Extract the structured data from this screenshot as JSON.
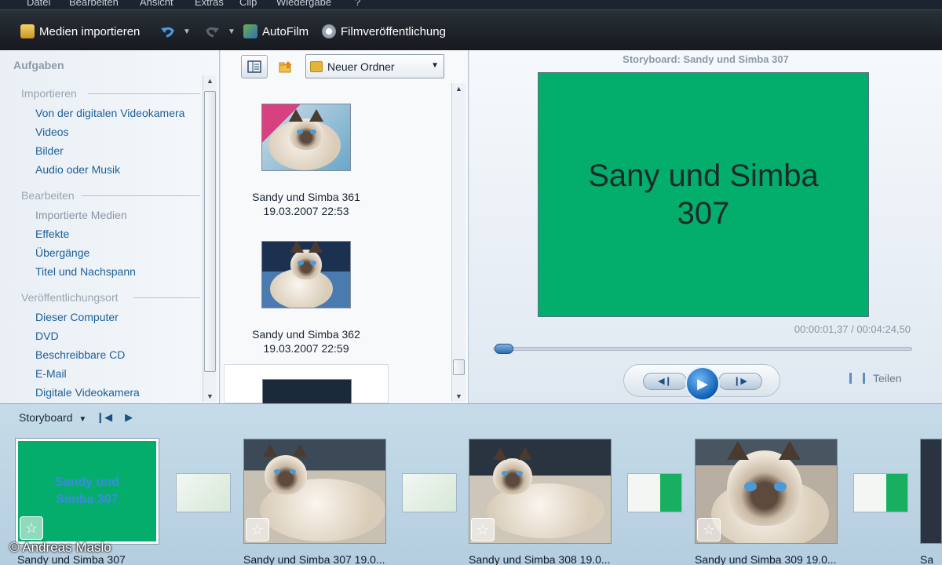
{
  "menu": {
    "items": [
      "Datei",
      "Bearbeiten",
      "Ansicht",
      "Extras",
      "Clip",
      "Wiedergabe",
      "?"
    ]
  },
  "toolbar": {
    "import_label": "Medien importieren",
    "autofilm_label": "AutoFilm",
    "publish_label": "Filmveröffentlichung"
  },
  "tasks": {
    "title": "Aufgaben",
    "sections": [
      {
        "title": "Importieren",
        "items": [
          "Von der digitalen Videokamera",
          "Videos",
          "Bilder",
          "Audio oder Musik"
        ]
      },
      {
        "title": "Bearbeiten",
        "items": [
          "Importierte Medien",
          "Effekte",
          "Übergänge",
          "Titel und Nachspann"
        ]
      },
      {
        "title": "Veröffentlichungsort",
        "items": [
          "Dieser Computer",
          "DVD",
          "Beschreibbare CD",
          "E-Mail",
          "Digitale Videokamera"
        ]
      }
    ]
  },
  "library": {
    "folder": "Neuer Ordner",
    "items": [
      {
        "name": "Sandy und Simba 361",
        "date": "19.03.2007 22:53"
      },
      {
        "name": "Sandy und Simba 362",
        "date": "19.03.2007 22:59"
      }
    ]
  },
  "preview": {
    "title": "Storyboard: Sandy und Simba 307",
    "screen_text": "Sany und Simba 307",
    "time": "00:00:01,37 / 00:04:24,50",
    "position_fraction": 0.005,
    "split_label": "Teilen"
  },
  "storyboard": {
    "label": "Storyboard",
    "clips": [
      {
        "title_text": "Sandy und Simba 307",
        "label": "Sandy und Simba 307"
      },
      {
        "label": "Sandy und Simba 307 19.0..."
      },
      {
        "label": "Sandy und Simba 308 19.0..."
      },
      {
        "label": "Sandy und Simba 309 19.0..."
      },
      {
        "label": "Sa"
      }
    ]
  },
  "copyright": "© Andreas Maslo",
  "colors": {
    "title_green": "#03ad6c",
    "link_blue": "#1d5f9a",
    "toolbar_dark": "#1c2430"
  }
}
